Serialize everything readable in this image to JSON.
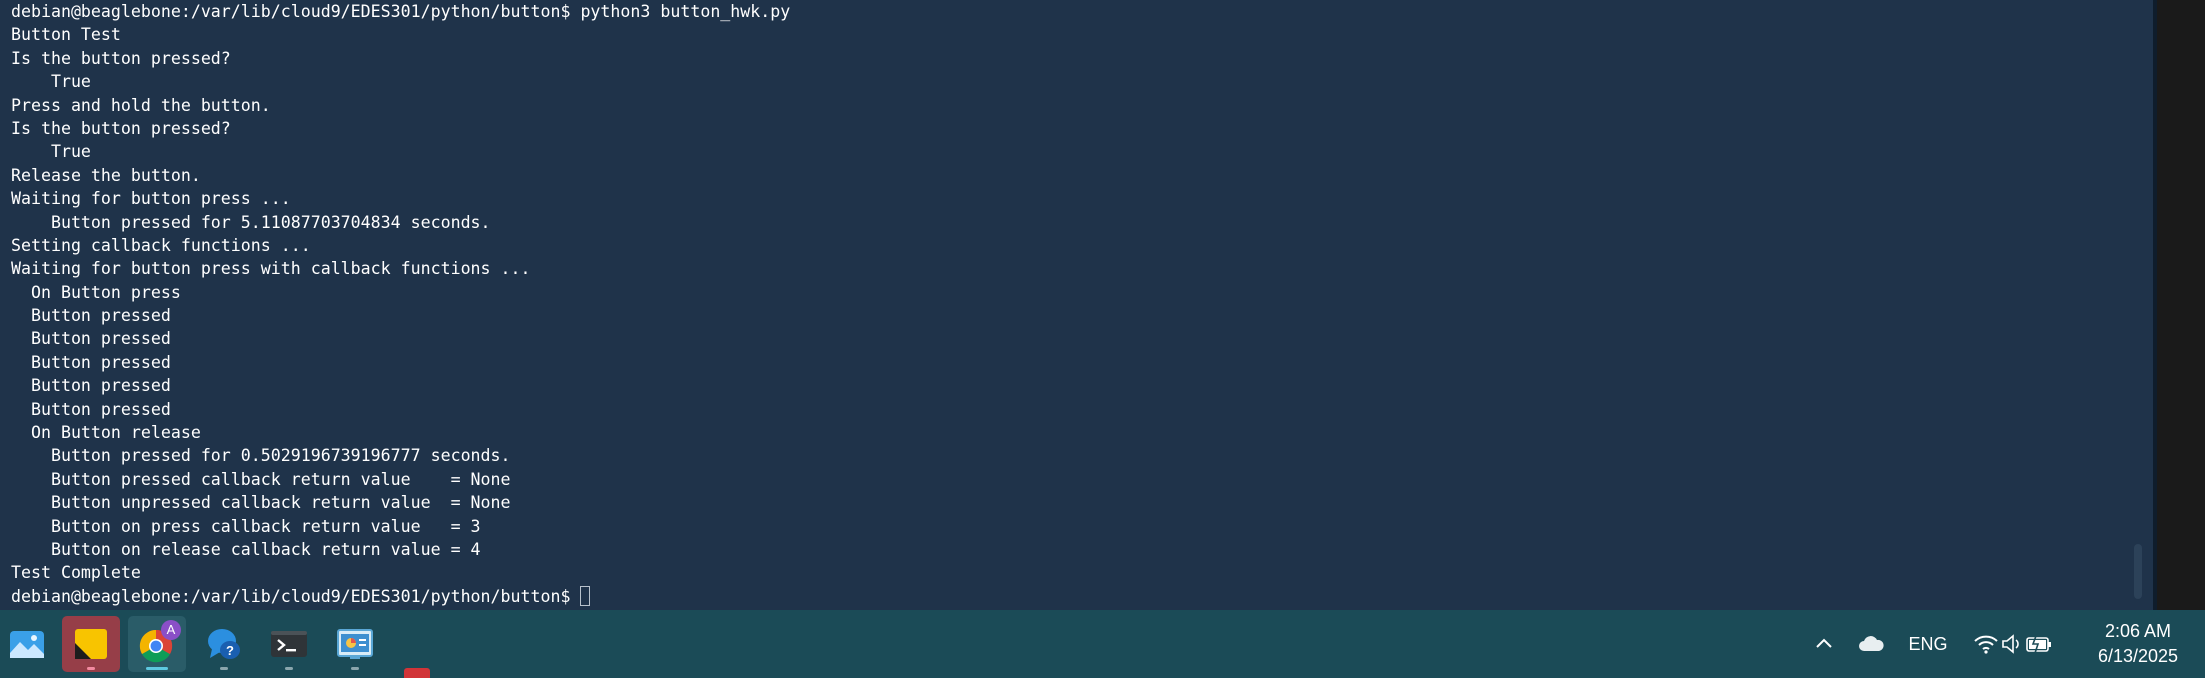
{
  "terminal": {
    "lines": [
      "debian@beaglebone:/var/lib/cloud9/EDES301/python/button$ python3 button_hwk.py",
      "Button Test",
      "Is the button pressed?",
      "    True",
      "Press and hold the button.",
      "Is the button pressed?",
      "    True",
      "Release the button.",
      "Waiting for button press ...",
      "    Button pressed for 5.11087703704834 seconds.",
      "Setting callback functions ...",
      "Waiting for button press with callback functions ...",
      "  On Button press",
      "  Button pressed",
      "  Button pressed",
      "  Button pressed",
      "  Button pressed",
      "  Button pressed",
      "  On Button release",
      "    Button pressed for 0.5029196739196777 seconds.",
      "    Button pressed callback return value    = None",
      "    Button unpressed callback return value  = None",
      "    Button on press callback return value   = 3",
      "    Button on release callback return value = 4",
      "Test Complete"
    ],
    "prompt": "debian@beaglebone:/var/lib/cloud9/EDES301/python/button$",
    "scroll_position": 0.97
  },
  "taskbar": {
    "apps": [
      {
        "name": "photos-app",
        "icon": "photos-icon",
        "active": false
      },
      {
        "name": "sticky-notes-app",
        "icon": "sticky-notes-icon",
        "active": false,
        "highlighted": true
      },
      {
        "name": "chrome-app",
        "icon": "chrome-icon",
        "active": true,
        "badge": "A"
      },
      {
        "name": "get-help-app",
        "icon": "help-icon",
        "active": false
      },
      {
        "name": "terminal-app",
        "icon": "terminal-icon",
        "active": false
      },
      {
        "name": "control-panel-app",
        "icon": "control-panel-icon",
        "active": false
      }
    ],
    "tray": {
      "language": "ENG",
      "time": "2:06 AM",
      "date": "6/13/2025",
      "icons": [
        "chevron-up-icon",
        "onedrive-cloud-icon",
        "wifi-icon",
        "volume-icon",
        "battery-icon"
      ]
    }
  }
}
